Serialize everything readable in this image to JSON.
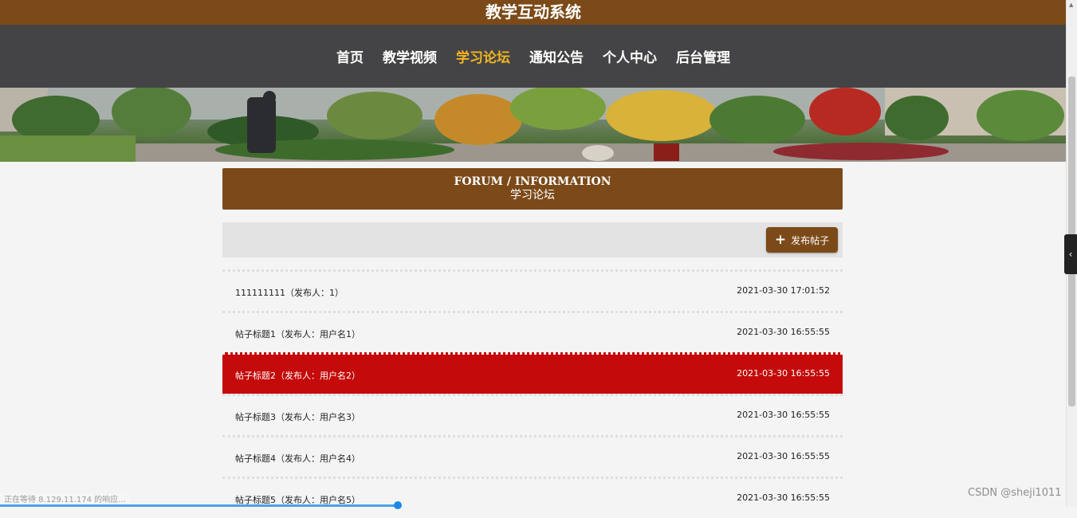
{
  "site": {
    "title": "教学互动系统"
  },
  "nav": {
    "items": [
      {
        "label": "首页",
        "active": false
      },
      {
        "label": "教学视频",
        "active": false
      },
      {
        "label": "学习论坛",
        "active": true
      },
      {
        "label": "通知公告",
        "active": false
      },
      {
        "label": "个人中心",
        "active": false
      },
      {
        "label": "后台管理",
        "active": false
      }
    ]
  },
  "section": {
    "title_en": "FORUM / INFORMATION",
    "title_cn": "学习论坛"
  },
  "toolbar": {
    "post_button": "发布帖子",
    "post_icon": "plus-icon"
  },
  "posts": [
    {
      "title": "111111111（发布人：1）",
      "date": "2021-03-30 17:01:52",
      "highlight": false
    },
    {
      "title": "帖子标题1（发布人：用户名1）",
      "date": "2021-03-30 16:55:55",
      "highlight": false
    },
    {
      "title": "帖子标题2（发布人：用户名2）",
      "date": "2021-03-30 16:55:55",
      "highlight": true
    },
    {
      "title": "帖子标题3（发布人：用户名3）",
      "date": "2021-03-30 16:55:55",
      "highlight": false
    },
    {
      "title": "帖子标题4（发布人：用户名4）",
      "date": "2021-03-30 16:55:55",
      "highlight": false
    },
    {
      "title": "帖子标题5（发布人：用户名5）",
      "date": "2021-03-30 16:55:55",
      "highlight": false
    }
  ],
  "status": {
    "text": "正在等待 8.129.11.174 的响应..."
  },
  "watermark": "CSDN @sheji1011",
  "colors": {
    "brand": "#7b4a18",
    "nav_bg": "#444446",
    "nav_active": "#f3b520",
    "highlight_row": "#c40a0a"
  }
}
